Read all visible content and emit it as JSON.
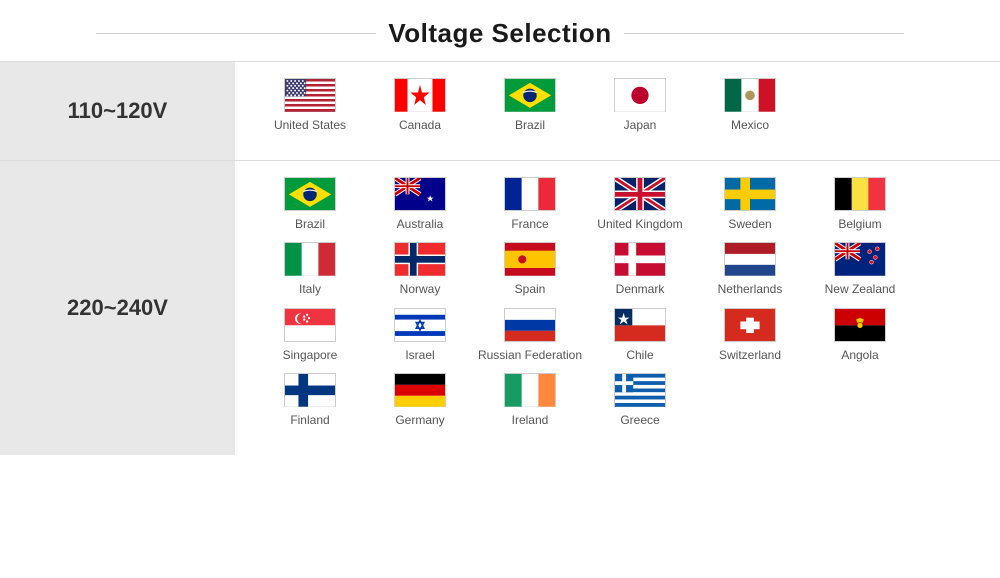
{
  "title": "Voltage Selection",
  "voltage_groups": [
    {
      "label": "110~120V",
      "countries": [
        {
          "name": "United States",
          "flag": "us"
        },
        {
          "name": "Canada",
          "flag": "ca"
        },
        {
          "name": "Brazil",
          "flag": "br"
        },
        {
          "name": "Japan",
          "flag": "jp"
        },
        {
          "name": "Mexico",
          "flag": "mx"
        }
      ]
    },
    {
      "label": "220~240V",
      "countries": [
        {
          "name": "Brazil",
          "flag": "br"
        },
        {
          "name": "Australia",
          "flag": "au"
        },
        {
          "name": "France",
          "flag": "fr"
        },
        {
          "name": "United Kingdom",
          "flag": "gb"
        },
        {
          "name": "Sweden",
          "flag": "se"
        },
        {
          "name": "Belgium",
          "flag": "be"
        },
        {
          "name": "Italy",
          "flag": "it"
        },
        {
          "name": "Norway",
          "flag": "no"
        },
        {
          "name": "Spain",
          "flag": "es"
        },
        {
          "name": "Denmark",
          "flag": "dk"
        },
        {
          "name": "Netherlands",
          "flag": "nl"
        },
        {
          "name": "New Zealand",
          "flag": "nz"
        },
        {
          "name": "Singapore",
          "flag": "sg"
        },
        {
          "name": "Israel",
          "flag": "il"
        },
        {
          "name": "Russian Federation",
          "flag": "ru"
        },
        {
          "name": "Chile",
          "flag": "cl"
        },
        {
          "name": "Switzerland",
          "flag": "ch"
        },
        {
          "name": "Angola",
          "flag": "ao"
        },
        {
          "name": "Finland",
          "flag": "fi"
        },
        {
          "name": "Germany",
          "flag": "de"
        },
        {
          "name": "Ireland",
          "flag": "ie"
        },
        {
          "name": "Greece",
          "flag": "gr"
        }
      ]
    }
  ]
}
